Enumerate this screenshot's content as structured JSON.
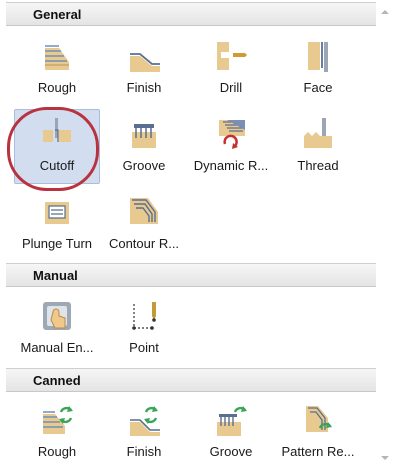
{
  "sections": [
    {
      "title": "General"
    },
    {
      "title": "Manual"
    },
    {
      "title": "Canned"
    }
  ],
  "general_tools": [
    {
      "label": "Rough",
      "icon": "rough-icon"
    },
    {
      "label": "Finish",
      "icon": "finish-icon"
    },
    {
      "label": "Drill",
      "icon": "drill-icon"
    },
    {
      "label": "Face",
      "icon": "face-icon"
    },
    {
      "label": "Cutoff",
      "icon": "cutoff-icon",
      "selected": true
    },
    {
      "label": "Groove",
      "icon": "groove-icon"
    },
    {
      "label": "Dynamic R...",
      "icon": "dynamic-rough-icon"
    },
    {
      "label": "Thread",
      "icon": "thread-icon"
    },
    {
      "label": "Plunge Turn",
      "icon": "plunge-turn-icon"
    },
    {
      "label": "Contour R...",
      "icon": "contour-rough-icon"
    }
  ],
  "manual_tools": [
    {
      "label": "Manual En...",
      "icon": "manual-entry-icon"
    },
    {
      "label": "Point",
      "icon": "point-icon"
    }
  ],
  "canned_tools": [
    {
      "label": "Rough",
      "icon": "canned-rough-icon"
    },
    {
      "label": "Finish",
      "icon": "canned-finish-icon"
    },
    {
      "label": "Groove",
      "icon": "canned-groove-icon"
    },
    {
      "label": "Pattern Re...",
      "icon": "pattern-repeat-icon"
    }
  ],
  "colors": {
    "stock": "#e8c98f",
    "stock_dark": "#b8945a",
    "tool_blue": "#7a8fb3",
    "arrow_green": "#3aa457",
    "highlight_ring": "#b8323f",
    "selection_bg": "#d2def0"
  }
}
